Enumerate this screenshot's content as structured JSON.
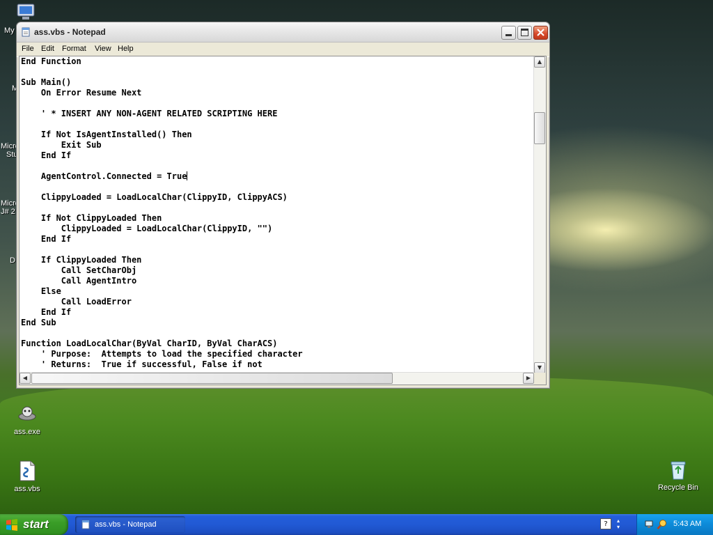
{
  "desktop": {
    "edge_labels": [
      "My",
      "M",
      "Micro",
      "Stu",
      "Micro",
      "J# 2",
      "D"
    ],
    "icons": [
      {
        "label": "ass.exe",
        "icon": "gear-app-icon"
      },
      {
        "label": "ass.vbs",
        "icon": "vbs-script-icon"
      },
      {
        "label": "Recycle Bin",
        "icon": "recycle-bin-icon"
      }
    ]
  },
  "window": {
    "title": "ass.vbs - Notepad",
    "menu": [
      "File",
      "Edit",
      "Format",
      "View",
      "Help"
    ],
    "code_lines": [
      "End Function",
      "",
      "Sub Main()",
      "    On Error Resume Next",
      "",
      "    ' * INSERT ANY NON-AGENT RELATED SCRIPTING HERE",
      "",
      "    If Not IsAgentInstalled() Then",
      "        Exit Sub",
      "    End If",
      "",
      "    AgentControl.Connected = True",
      "",
      "    ClippyLoaded = LoadLocalChar(ClippyID, ClippyACS)",
      "",
      "    If Not ClippyLoaded Then",
      "        ClippyLoaded = LoadLocalChar(ClippyID, \"\")",
      "    End If",
      "",
      "    If ClippyLoaded Then",
      "        Call SetCharObj",
      "        Call AgentIntro",
      "    Else",
      "        Call LoadError",
      "    End If",
      "End Sub",
      "",
      "Function LoadLocalChar(ByVal CharID, ByVal CharACS)",
      "    ' Purpose:  Attempts to load the specified character",
      "    ' Returns:  True if successful, False if not"
    ],
    "caret_line": 11
  },
  "taskbar": {
    "start_label": "start",
    "task_button_label": "ass.vbs - Notepad",
    "lang_indicator": "?",
    "clock": "5:43 AM"
  },
  "colors": {
    "taskbar_blue": "#245edb",
    "start_green": "#3a9d27",
    "tray_blue": "#0c8ad8",
    "close_red": "#d6482a"
  }
}
